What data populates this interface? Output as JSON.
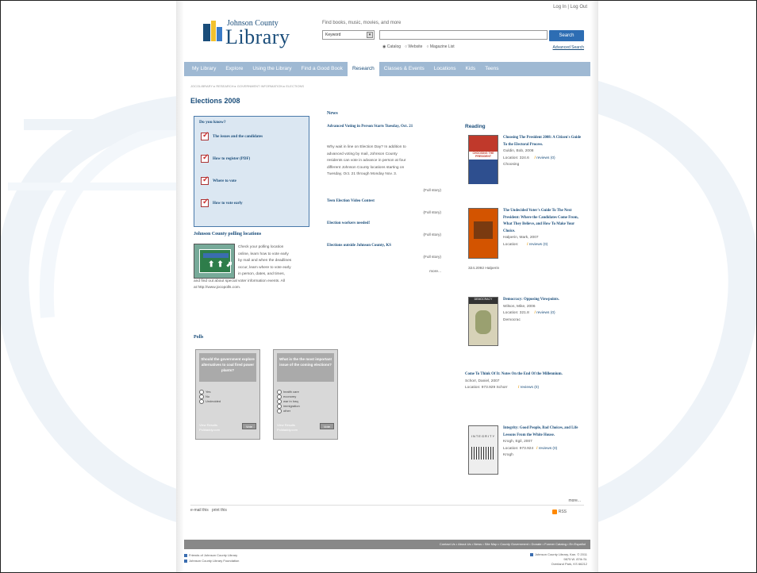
{
  "header": {
    "login_links": "Log In  |  Log Out",
    "logo_line1": "Johnson County",
    "logo_line2": "Library",
    "search_label": "Find books, music, movies, and more",
    "search_type": "Keyword",
    "search_button": "Search",
    "radio_catalog": "Catalog",
    "radio_website": "Website",
    "radio_magazine": "Magazine List",
    "advanced_search": "Advanced Search"
  },
  "nav": {
    "items": [
      "My Library",
      "Explore",
      "Using the Library",
      "Find a Good Book",
      "Research",
      "Classes & Events",
      "Locations",
      "Kids",
      "Teens"
    ],
    "active": "Research"
  },
  "breadcrumb": "JOCOLIBRARY ▸ RESEARCH ▸ GOVERNMENT INFORMATION ▸ ELECTIONS",
  "page_title": "Elections 2008",
  "do_you_know": {
    "title": "Do you know?",
    "items": [
      "The issues and the candidates",
      "How to register (PDF)",
      "Where to vote",
      "How to vote early"
    ]
  },
  "polling": {
    "title": "Johnson County polling locations",
    "text_indented": [
      "Check your polling location",
      "online, learn how to vote early",
      "by mail and when the deadlines",
      "occur, learn where to vote early",
      "in person, dates, and times,"
    ],
    "text_full": [
      "and find out about special voter information events. All",
      "at http://www.jocopolls.com."
    ]
  },
  "polls": {
    "title": "Polls",
    "cards": [
      {
        "question": "Should the government explore alternatives to coal fired power plants?",
        "options": [
          "Yes",
          "No",
          "Undecided"
        ],
        "results": "View Results",
        "credit": "Polldaddy.com",
        "vote": "Vote"
      },
      {
        "question": "What is the the most important issue of the coming elections?",
        "options": [
          "health care",
          "economy",
          "war in Iraq",
          "immigration",
          "other"
        ],
        "results": "View Results",
        "credit": "Polldaddy.com",
        "vote": "Vote"
      }
    ]
  },
  "news": {
    "title": "News",
    "items": [
      {
        "headline": "Advanced Voting in Person Starts Tuesday, Oct. 21",
        "body": [
          "Why wait in line on Election Day? In addition to",
          "advanced voting by mail, Johnson County",
          "residents can vote in advance in person at four",
          "different Johnson County locations starting on",
          "Tuesday, Oct. 21 through Monday Nov. 3."
        ],
        "full": "(Full story)"
      },
      {
        "headline": "Teen Election Video Contest",
        "full": "(Full story)"
      },
      {
        "headline": "Election workers needed!",
        "full": "(Full story)"
      },
      {
        "headline": "Elections outside Johnson County, KS",
        "full": "(Full story)"
      }
    ],
    "more": "more..."
  },
  "reading": {
    "title": "Reading",
    "books": [
      {
        "title": "Choosing The President 2008: A Citizen's Guide To the Electoral Process.",
        "author": "Guldin, Bob, 2008",
        "location": "Location: 324.6",
        "call": "Choosing",
        "reviews": "reviews (0)",
        "cover_color": "#c0392b"
      },
      {
        "title": "The Undecided Voter's Guide To The Next President: Where the Candidates Come From, What They Believe, and How To Make Your Choice.",
        "author": "Halperin, Mark, 2007",
        "location": "Location:",
        "call": "324.2092 Halperin",
        "reviews": "reviews (0)",
        "cover_color": "#d35400"
      },
      {
        "title": "Democracy: Opposing Viewpoints.",
        "author": "Wilson, Mike, 2006",
        "location": "Location: 321.8",
        "call": "Democrac",
        "reviews": "reviews (0)",
        "cover_color": "#5d6d3a"
      },
      {
        "title": "Come To Think Of It: Notes On the End Of the Millennium.",
        "author": "Schorr, Daniel, 2007",
        "location": "Location: 973.929 Schorr",
        "call": "",
        "reviews": "reviews (0)",
        "cover_color": ""
      },
      {
        "title": "Integrity: Good People, Bad Choices, and Life Lessons From the White House.",
        "author": "Krogh, Egil, 2007",
        "location": "Location: 973.924",
        "call": "Krogh",
        "reviews": "reviews (0)",
        "cover_color": "#eeeeee"
      }
    ],
    "more": "more..."
  },
  "page_actions": {
    "email": "e-mail this",
    "print": "print this",
    "rss": "RSS"
  },
  "footer": {
    "bar_links": "Contact Us • About Us • News • Site Map • County Government • Donate • Former Catalog • En Español",
    "left_1": "Friends of Johnson County Library",
    "left_2": "Johnson County Library Foundation",
    "right_1": "Johnson County Library, Kan. © 2011",
    "right_2": "9875 W. 87th St.",
    "right_3": "Overland Park, KS 66212"
  }
}
